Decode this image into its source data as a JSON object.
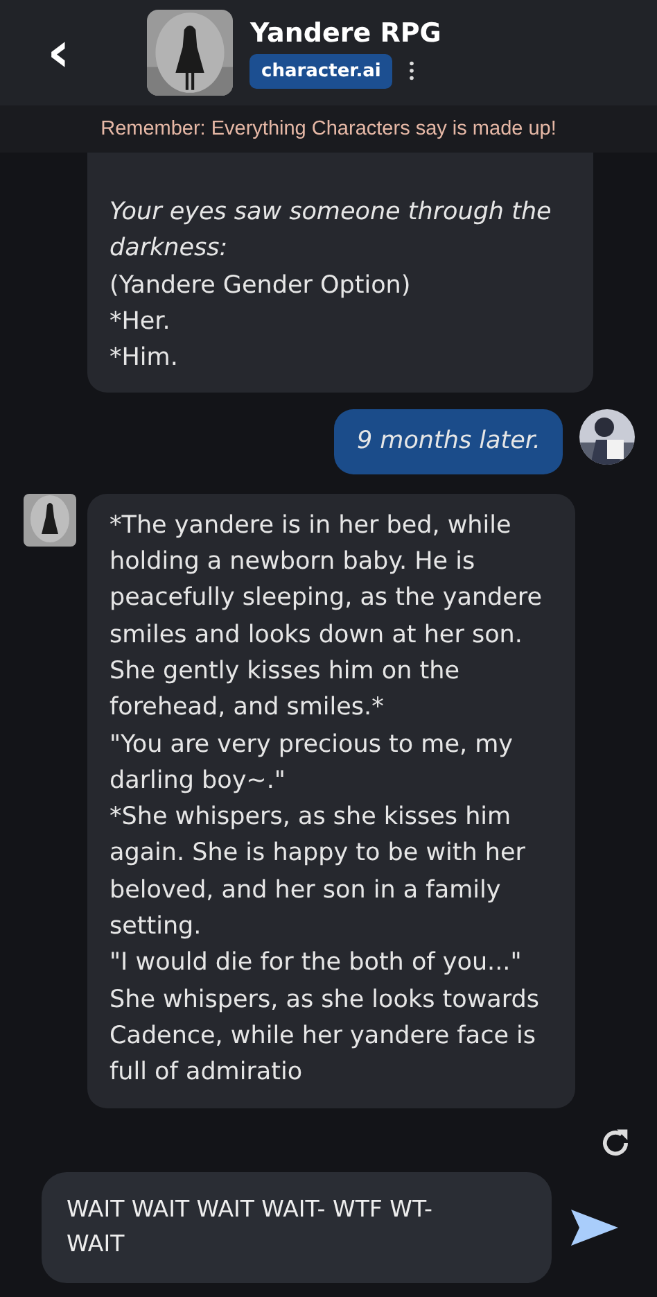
{
  "header": {
    "back": "‹",
    "title": "Yandere RPG",
    "badge": "character.ai"
  },
  "banner": "Remember: Everything Characters say is made up!",
  "messages": [
    {
      "kind": "continuation",
      "paragraphs": [
        {
          "text": "Your eyes saw someone through the darkness:",
          "italic": true
        },
        {
          "text": "(Yandere Gender Option)",
          "italic": false
        },
        {
          "text": "*Her.",
          "italic": false
        },
        {
          "text": "*Him.",
          "italic": false
        }
      ]
    },
    {
      "kind": "user",
      "paragraphs": [
        {
          "text": "9 months later.",
          "italic": true
        }
      ]
    },
    {
      "kind": "bot",
      "paragraphs": [
        {
          "text": "*The yandere is in her bed, while holding a newborn baby. He is peacefully sleeping, as the yandere smiles and looks down at her son. She gently kisses him on the forehead, and smiles.*",
          "italic": false
        },
        {
          "text": "\"You are very precious to me, my darling boy~.\"",
          "italic": false
        },
        {
          "text": "*She whispers, as she kisses him again. She is happy to be with her beloved, and her son in a family setting.",
          "italic": false
        },
        {
          "text": "\"I would die for the both of you...\"",
          "italic": false
        },
        {
          "text": "She whispers, as she looks towards Cadence, while her yandere face is full of admiratio",
          "italic": false
        }
      ]
    }
  ],
  "composer": {
    "value": "WAIT WAIT WAIT WAIT- WTF WT-WAIT"
  }
}
